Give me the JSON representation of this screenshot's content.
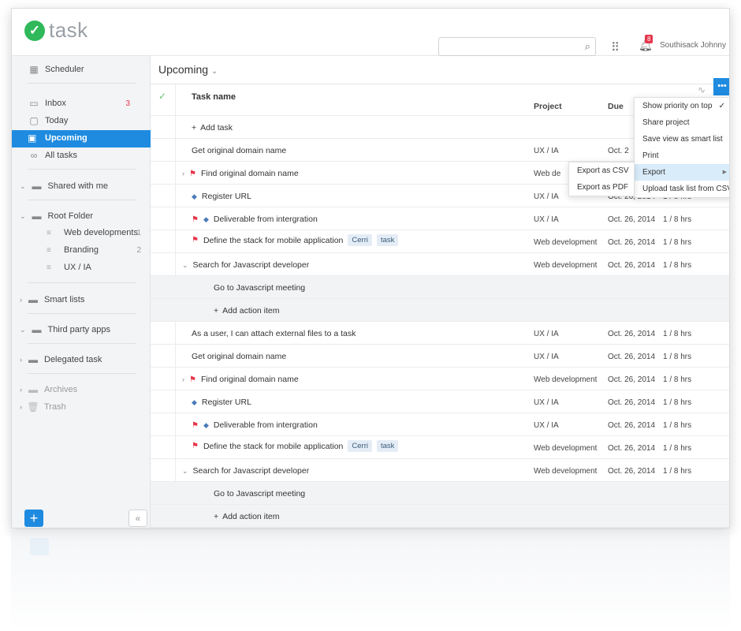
{
  "app": {
    "logo_text": "task"
  },
  "header": {
    "user_name": "Southisack Johnny",
    "notification_count": "8"
  },
  "sidebar": {
    "scheduler": "Scheduler",
    "inbox": {
      "label": "Inbox",
      "count": "3"
    },
    "today": "Today",
    "upcoming": "Upcoming",
    "all_tasks": "All tasks",
    "shared": "Shared with me",
    "root_folder": "Root Folder",
    "folders": [
      {
        "label": "Web developments",
        "count": "1"
      },
      {
        "label": "Branding",
        "count": "2"
      },
      {
        "label": "UX / IA",
        "count": ""
      }
    ],
    "smart_lists": "Smart lists",
    "third_party": "Third party apps",
    "delegated": "Delegated task",
    "archives": "Archives",
    "trash": "Trash"
  },
  "main": {
    "title": "Upcoming",
    "columns": {
      "task": "Task name",
      "project": "Project",
      "due": "Due"
    },
    "add_task": "Add task",
    "add_action": "Add action item",
    "rows": [
      {
        "name": "Get original domain name",
        "project": "UX / IA",
        "due": "Oct. 2",
        "est": ""
      },
      {
        "name": "Find original domain name",
        "project": "Web de",
        "due": "",
        "est": ""
      },
      {
        "name": "Register URL",
        "project": "UX / IA",
        "due": "Oct. 26, 2014",
        "est": "1 / 8 hrs"
      },
      {
        "name": "Deliverable from intergration",
        "project": "UX / IA",
        "due": "Oct. 26, 2014",
        "est": "1 / 8 hrs"
      },
      {
        "name": "Define the stack for mobile application",
        "project": "Web development",
        "due": "Oct. 26, 2014",
        "est": "1 / 8 hrs",
        "tags": [
          "Cerri",
          "task"
        ]
      },
      {
        "name": "Search for Javascript developer",
        "project": "Web development",
        "due": "Oct. 26, 2014",
        "est": "1 / 8 hrs"
      },
      {
        "name": "Go to Javascript meeting"
      },
      {
        "name": "As a user, I can attach external files to a task",
        "project": "UX / IA",
        "due": "Oct. 26, 2014",
        "est": "1 / 8 hrs"
      },
      {
        "name": "Get original domain name",
        "project": "UX / IA",
        "due": "Oct. 26, 2014",
        "est": "1 / 8 hrs"
      },
      {
        "name": "Find original domain name",
        "project": "Web development",
        "due": "Oct. 26, 2014",
        "est": "1 / 8 hrs"
      },
      {
        "name": "Register URL",
        "project": "UX / IA",
        "due": "Oct. 26, 2014",
        "est": "1 / 8 hrs"
      },
      {
        "name": "Deliverable from intergration",
        "project": "UX / IA",
        "due": "Oct. 26, 2014",
        "est": "1 / 8 hrs"
      },
      {
        "name": "Define the stack for mobile application",
        "project": "Web development",
        "due": "Oct. 26, 2014",
        "est": "1 / 8 hrs",
        "tags": [
          "Cerri",
          "task"
        ]
      },
      {
        "name": "Search for Javascript developer",
        "project": "Web development",
        "due": "Oct. 26, 2014",
        "est": "1 / 8 hrs"
      },
      {
        "name": "Go to Javascript meeting"
      }
    ]
  },
  "menu": {
    "items": [
      "Show priority on top",
      "Share project",
      "Save view as smart list",
      "Print",
      "Export",
      "Upload task list from CSV"
    ],
    "submenu": [
      "Export as CSV",
      "Export as PDF"
    ]
  },
  "colors": {
    "accent": "#1e8be0",
    "brand": "#2fb95a",
    "flag": "#e5364a"
  }
}
